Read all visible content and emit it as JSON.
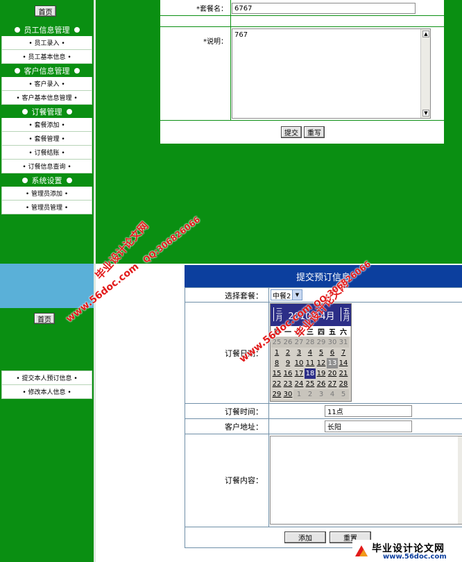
{
  "top": {
    "home_button": "首页",
    "menu": [
      {
        "header": "员工信息管理",
        "items": [
          "• 员工录入 •",
          "• 员工基本信息 •"
        ]
      },
      {
        "header": "客户信息管理",
        "items": [
          "• 客户录入 •",
          "• 客户基本信息管理 •"
        ]
      },
      {
        "header": "订餐管理",
        "items": [
          "• 套餐添加 •",
          "• 套餐管理 •",
          "• 订餐结账 •",
          "• 订餐信息查询 •"
        ]
      },
      {
        "header": "系统设置",
        "items": [
          "• 管理员添加 •",
          "• 管理员管理 •"
        ]
      }
    ],
    "form": {
      "name_label": "*套餐名：",
      "name_value": "6767",
      "desc_label": "*说明：",
      "desc_value": "767",
      "submit": "提交",
      "reset": "重写"
    }
  },
  "bottom": {
    "home_button": "首页",
    "menu": [
      "• 提交本人预订信息 •",
      "• 修改本人信息 •"
    ],
    "form": {
      "title": "提交预订信息",
      "package_label": "选择套餐：",
      "package_selected": "中餐2",
      "date_label": "订餐日期：",
      "time_label": "订餐时间：",
      "time_value": "11点",
      "address_label": "客户地址：",
      "address_value": "长阳",
      "content_label": "订餐内容：",
      "content_value": "",
      "add": "添加",
      "reset": "重置"
    },
    "calendar": {
      "prev": "三月",
      "year_month": "2010年4月",
      "next": "五月",
      "weekdays": [
        "日",
        "一",
        "二",
        "三",
        "四",
        "五",
        "六"
      ],
      "weeks": [
        [
          "25",
          "26",
          "27",
          "28",
          "29",
          "30",
          "31"
        ],
        [
          "1",
          "2",
          "3",
          "4",
          "5",
          "6",
          "7"
        ],
        [
          "8",
          "9",
          "10",
          "11",
          "12",
          "13",
          "14"
        ],
        [
          "15",
          "16",
          "17",
          "18",
          "19",
          "20",
          "21"
        ],
        [
          "22",
          "23",
          "24",
          "25",
          "26",
          "27",
          "28"
        ],
        [
          "29",
          "30",
          "1",
          "2",
          "3",
          "4",
          "5"
        ]
      ],
      "selected": "18",
      "today": "13"
    }
  },
  "watermarks": {
    "site_cn": "毕业设计论文网",
    "site_url": "www.56doc.com",
    "qq": "QQ:306826066"
  },
  "colors": {
    "nav_green": "#0a8f12",
    "header_blue": "#0c3f9e",
    "sky_blue": "#5ab0d8",
    "calendar_navy": "#2c2e87"
  }
}
